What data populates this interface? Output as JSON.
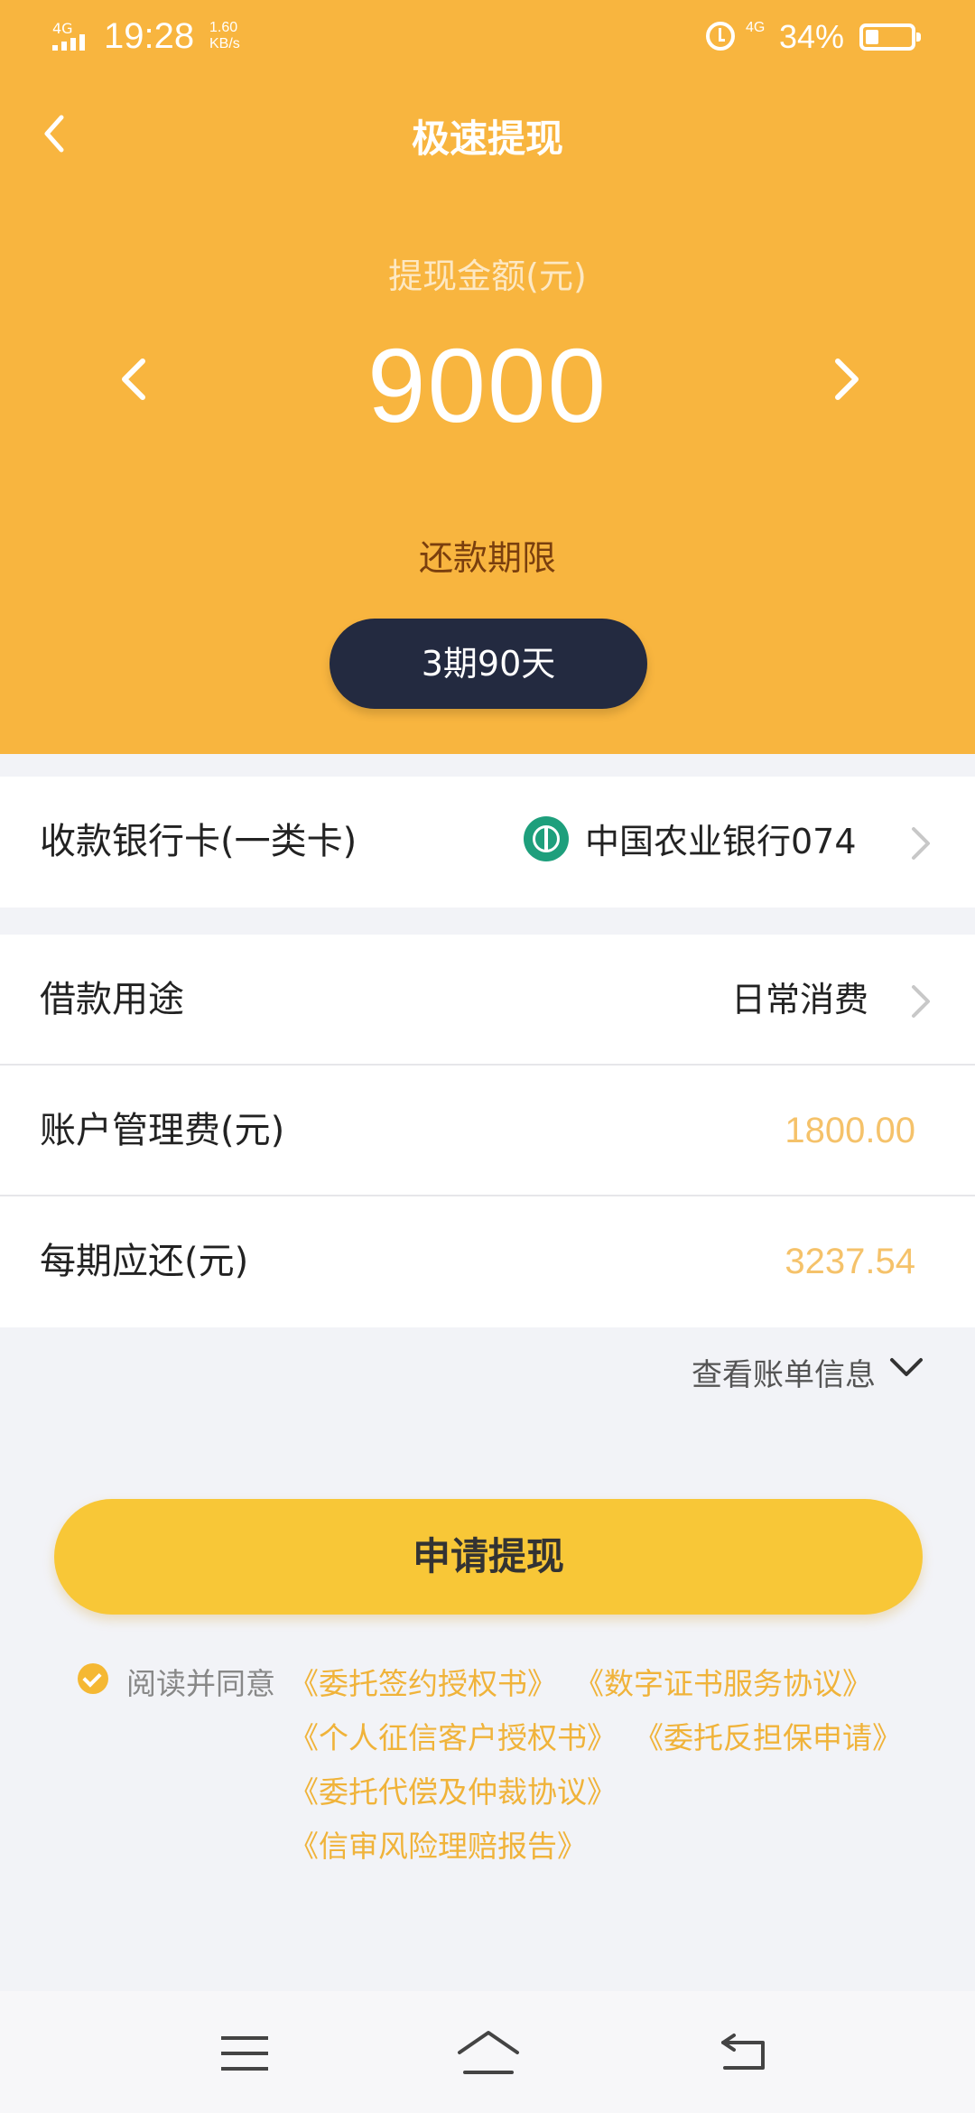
{
  "status_bar": {
    "network": "4G",
    "time": "19:28",
    "speed_value": "1.60",
    "speed_unit": "KB/s",
    "network_2": "4G",
    "battery": "34%",
    "battery_level": 0.34
  },
  "header": {
    "title": "极速提现",
    "amount_label": "提现金额(元)",
    "amount": "9000",
    "term_label": "还款期限",
    "term_value": "3期90天"
  },
  "bank_row": {
    "label": "收款银行卡(一类卡)",
    "bank": "中国农业银行074",
    "icon": "abc-bank-icon"
  },
  "rows": {
    "purpose_label": "借款用途",
    "purpose_value": "日常消费",
    "fee_label": "账户管理费(元)",
    "fee_value": "1800.00",
    "installment_label": "每期应还(元)",
    "installment_value": "3237.54"
  },
  "bill_link": "查看账单信息",
  "apply_button": "申请提现",
  "agreement": {
    "prefix": "阅读并同意",
    "docs": [
      "《委托签约授权书》",
      "《数字证书服务协议》",
      "《个人征信客户授权书》",
      "《委托反担保申请》",
      "《委托代偿及仲裁协议》",
      "《信审风险理赔报告》"
    ]
  },
  "colors": {
    "header_bg": "#f8b53f",
    "pill_bg": "#232a40",
    "accent_gold": "#f5c26a",
    "button_bg": "#f8c737"
  }
}
